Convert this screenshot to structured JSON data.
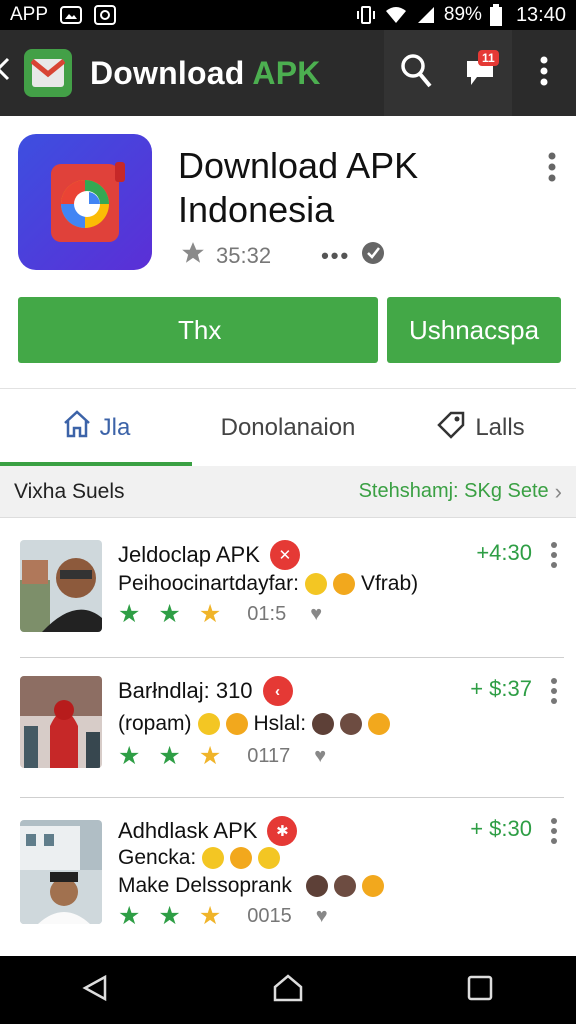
{
  "status_bar": {
    "app_label": "APP",
    "battery": "89%",
    "time": "13:40",
    "icons": [
      "image-icon",
      "screenshot-icon",
      "vibrate-icon",
      "wifi-icon",
      "signal-icon",
      "battery-icon"
    ]
  },
  "app_bar": {
    "title_main": "Download ",
    "title_accent": "APK",
    "notification_count": "11",
    "accent_color": "#4caf50"
  },
  "app_header": {
    "name": "Download APK Indonesia",
    "rating": "35:32",
    "dots": "•••",
    "install_label": "Thx",
    "secondary_label": "Ushnacspa"
  },
  "tabs": [
    {
      "label": "Jla",
      "icon": "home-icon",
      "active": true
    },
    {
      "label": "Donolanaion",
      "active": false
    },
    {
      "label": "Lalls",
      "icon": "tag-icon",
      "active": false
    }
  ],
  "section": {
    "title": "Vixha Suels",
    "link": "Stehshamj: SKg Sete"
  },
  "items": [
    {
      "title": "Jeldoclap APK",
      "subtitle_a": "Peihoocinartdayfar:",
      "subtitle_b": "Vfrab)",
      "subtitle_c": "",
      "count": "01:5",
      "price": "+4:30"
    },
    {
      "title": "Barłndlaj: 310",
      "subtitle_a": "(ropam)",
      "subtitle_b": "Hslal:",
      "subtitle_c": "",
      "count": "0117",
      "price": "+ $:37"
    },
    {
      "title": "Adhdlask APK",
      "subtitle_a": "Gencka:",
      "subtitle_b": "",
      "subtitle_c": "Make Delssoprank",
      "count": "0015",
      "price": "+ $:30"
    }
  ],
  "colors": {
    "green": "#43a847",
    "red": "#e53935",
    "tab_active": "#3c63a8",
    "appbar": "#2b2b2b"
  }
}
